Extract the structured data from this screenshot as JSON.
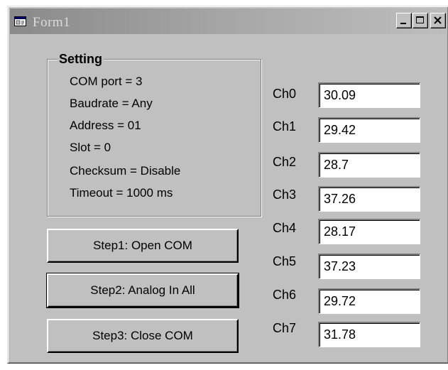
{
  "window": {
    "title": "Form1",
    "icon": "form-window-icon",
    "controls": {
      "minimize_icon": "minimize-icon",
      "maximize_icon": "maximize-icon",
      "close_icon": "close-icon"
    }
  },
  "setting": {
    "title": "Setting",
    "lines": [
      "COM port = 3",
      "Baudrate = Any",
      "Address = 01",
      "Slot = 0",
      "Checksum = Disable",
      "Timeout = 1000 ms"
    ]
  },
  "buttons": {
    "open_com": "Step1: Open COM",
    "analog_in_all": "Step2: Analog In All",
    "close_com": "Step3: Close COM"
  },
  "channels": [
    {
      "label": "Ch0",
      "value": "30.09"
    },
    {
      "label": "Ch1",
      "value": "29.42"
    },
    {
      "label": "Ch2",
      "value": "28.7"
    },
    {
      "label": "Ch3",
      "value": "37.26"
    },
    {
      "label": "Ch4",
      "value": "28.17"
    },
    {
      "label": "Ch5",
      "value": "37.23"
    },
    {
      "label": "Ch6",
      "value": "29.72"
    },
    {
      "label": "Ch7",
      "value": "31.78"
    }
  ]
}
